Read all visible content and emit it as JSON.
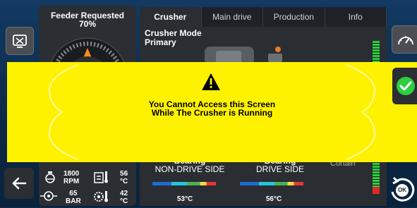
{
  "feeder": {
    "title_line1": "Feeder Requested",
    "title_line2": "70%"
  },
  "tabs": [
    {
      "label": "Crusher",
      "active": true
    },
    {
      "label": "Main drive",
      "active": false
    },
    {
      "label": "Production",
      "active": false
    },
    {
      "label": "Info",
      "active": false
    }
  ],
  "crusher_mode": {
    "line1": "Crusher Mode",
    "line2": "Primary"
  },
  "overlay": {
    "line1": "You Cannot Access this Screen",
    "line2": "While The Crusher is Running",
    "color": "#fff200"
  },
  "stats": {
    "rpm_value": "1800",
    "rpm_unit": "RPM",
    "temp1_value": "56",
    "temp1_unit": "°C",
    "bar_value": "65",
    "bar_unit": "BAR",
    "temp2_value": "42",
    "temp2_unit": "°C"
  },
  "bearings": [
    {
      "title": "Bearing",
      "subtitle": "NON-DRIVE SIDE",
      "temp": "53°C"
    },
    {
      "title": "Bearing",
      "subtitle": "DRIVE SIDE",
      "temp": "56°C"
    }
  ],
  "ok_label": "OK",
  "partial_text": "Curtain",
  "icons": {
    "top_left": "screen-off-icon",
    "back": "back-arrow-icon",
    "top_right": "speedometer-icon",
    "check": "checkmark-icon",
    "ok": "ok-rotate-icon",
    "warning": "warning-icon"
  },
  "colors": {
    "accent_green": "#2ecc40",
    "background": "#0d2a4a"
  }
}
